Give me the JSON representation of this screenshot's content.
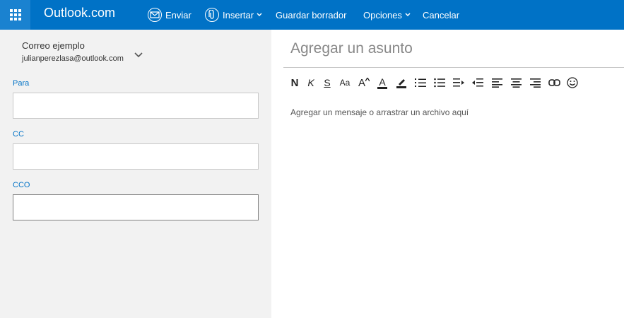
{
  "header": {
    "brand": "Outlook.com",
    "send_label": "Enviar",
    "insert_label": "Insertar",
    "save_draft_label": "Guardar borrador",
    "options_label": "Opciones",
    "cancel_label": "Cancelar",
    "bar_color": "#0072c6"
  },
  "account": {
    "name": "Correo ejemplo",
    "email": "julianperezlasa@outlook.com"
  },
  "fields": {
    "to_label": "Para",
    "cc_label": "CC",
    "bcc_label": "CCO",
    "to_value": "",
    "cc_value": "",
    "bcc_value": ""
  },
  "compose": {
    "subject_placeholder": "Agregar un asunto",
    "body_placeholder": "Agregar un mensaje o arrastrar un archivo aquí"
  },
  "toolbar": {
    "bold": "N",
    "italic": "K",
    "underline": "S",
    "font_size": "Aa",
    "grow_font": "A",
    "font_color": "A",
    "icons": [
      "bold-icon",
      "italic-icon",
      "underline-icon",
      "font-size-icon",
      "grow-font-icon",
      "font-color-icon",
      "highlight-icon",
      "numbered-list-icon",
      "bullet-list-icon",
      "decrease-indent-icon",
      "increase-indent-icon",
      "align-left-icon",
      "align-center-icon",
      "align-right-icon",
      "link-icon",
      "emoji-icon"
    ]
  }
}
